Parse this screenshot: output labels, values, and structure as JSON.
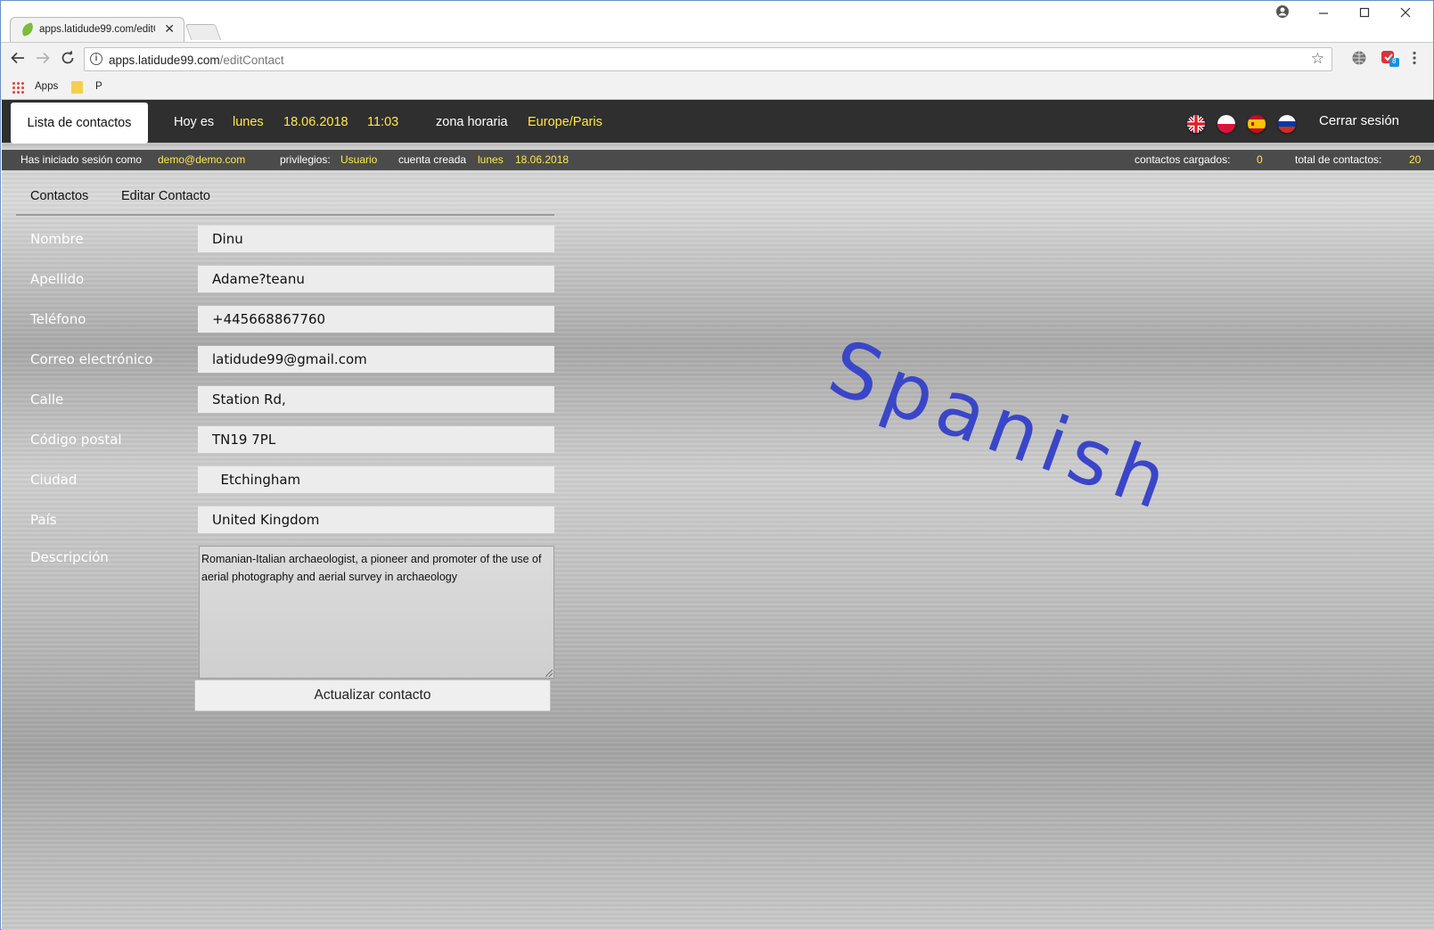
{
  "browser": {
    "tab_title": "apps.latidude99.com/editContact",
    "tab_close": "✕",
    "url_host": "apps.latidude99.com",
    "url_path": "/editContact",
    "bookmarks": {
      "apps": "Apps",
      "p": "P"
    },
    "extension_badge": "8"
  },
  "topnav": {
    "contacts_list": "Lista de contactos",
    "today_label": "Hoy es",
    "weekday": "lunes",
    "date": "18.06.2018",
    "time": "11:03",
    "timezone_label": "zona horaria",
    "timezone": "Europe/Paris",
    "logout": "Cerrar sesión"
  },
  "status": {
    "logged_as_label": "Has iniciado sesión como",
    "user": "demo@demo.com",
    "privileges_label": "privilegios:",
    "privileges": "Usuario",
    "account_created_label": "cuenta creada",
    "created_weekday": "lunes",
    "created_date": "18.06.2018",
    "loaded_label": "contactos cargados:",
    "loaded": "0",
    "total_label": "total de contactos:",
    "total": "20"
  },
  "breadcrumb": {
    "contacts": "Contactos",
    "edit": "Editar Contacto"
  },
  "form": {
    "fields": [
      {
        "label": "Nombre",
        "value": "Dinu"
      },
      {
        "label": "Apellido",
        "value": "Adame?teanu"
      },
      {
        "label": "Teléfono",
        "value": "+445668867760"
      },
      {
        "label": "Correo electrónico",
        "value": "latidude99@gmail.com"
      },
      {
        "label": "Calle",
        "value": "Station Rd,"
      },
      {
        "label": "Código postal",
        "value": "TN19 7PL"
      },
      {
        "label": "Ciudad",
        "value": "  Etchingham"
      },
      {
        "label": "País",
        "value": "United Kingdom"
      }
    ],
    "description_label": "Descripción",
    "description": "Romanian-Italian archaeologist, a pioneer and promoter of the use of aerial photography and aerial survey in archaeology",
    "submit": "Actualizar contacto"
  },
  "watermark": "Spanish",
  "colors": {
    "accent_yellow": "#ffe84a",
    "nav_bg": "#2f2f2f",
    "watermark": "#3a46c8"
  }
}
